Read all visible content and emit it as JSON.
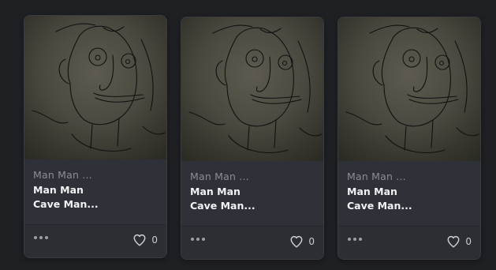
{
  "cards": [
    {
      "collection": "Man Man ...",
      "title_line1": "Man Man",
      "title_line2": "Cave Man...",
      "likes": "0"
    },
    {
      "collection": "Man Man ...",
      "title_line1": "Man Man",
      "title_line2": "Cave Man...",
      "likes": "0"
    },
    {
      "collection": "Man Man ...",
      "title_line1": "Man Man",
      "title_line2": "Cave Man...",
      "likes": "0"
    }
  ],
  "icons": {
    "more": "more-horizontal-icon",
    "like": "heart-outline-icon"
  },
  "colors": {
    "background": "#1f2024",
    "card": "#2c2e34",
    "info_panel": "#2f3139",
    "art_tone": "#4c4a40",
    "text_primary": "#f2f2f4",
    "text_muted": "#8b8d93"
  }
}
